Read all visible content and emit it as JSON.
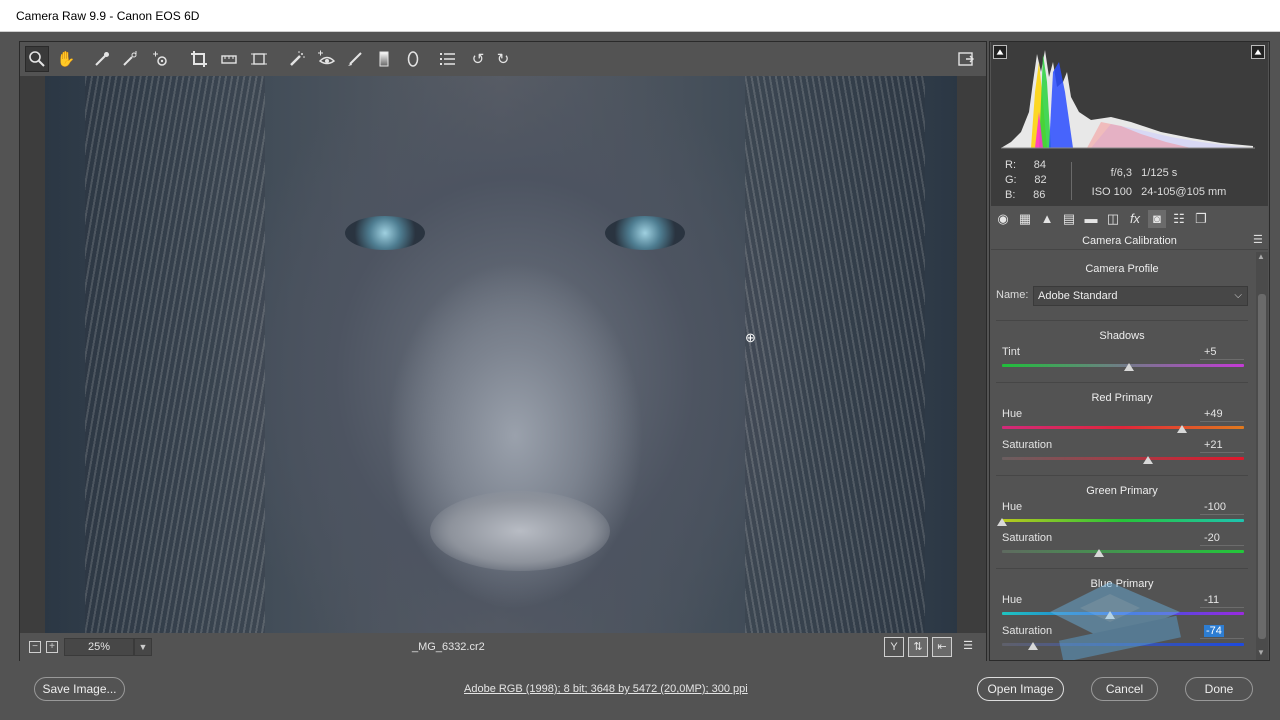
{
  "window": {
    "title": "Camera Raw 9.9  -  Canon EOS 6D"
  },
  "toolbar": {
    "tools": [
      "zoom-tool",
      "hand-tool",
      "white-balance-tool",
      "color-sampler-tool",
      "targeted-adjustment-tool",
      "crop-tool",
      "straighten-tool",
      "transform-tool",
      "spot-removal-tool",
      "red-eye-tool",
      "adjustment-brush-tool",
      "graduated-filter-tool",
      "radial-filter-tool",
      "preferences-tool",
      "rotate-ccw-tool",
      "rotate-cw-tool"
    ],
    "active_tool": "zoom-tool"
  },
  "preview": {
    "zoom_value": "25%",
    "filename": "_MG_6332.cr2"
  },
  "readout": {
    "r_label": "R:",
    "r_value": "84",
    "g_label": "G:",
    "g_value": "82",
    "b_label": "B:",
    "b_value": "86",
    "aperture": "f/6,3",
    "shutter": "1/125 s",
    "iso": "ISO 100",
    "lens": "24-105@105 mm"
  },
  "panel": {
    "title": "Camera Calibration",
    "camera_profile_heading": "Camera Profile",
    "name_label": "Name:",
    "name_value": "Adobe Standard",
    "shadows": {
      "heading": "Shadows",
      "tint_label": "Tint",
      "tint_value": "+5"
    },
    "red_primary": {
      "heading": "Red Primary",
      "hue_label": "Hue",
      "hue_value": "+49",
      "sat_label": "Saturation",
      "sat_value": "+21"
    },
    "green_primary": {
      "heading": "Green Primary",
      "hue_label": "Hue",
      "hue_value": "-100",
      "sat_label": "Saturation",
      "sat_value": "-20"
    },
    "blue_primary": {
      "heading": "Blue Primary",
      "hue_label": "Hue",
      "hue_value": "-11",
      "sat_label": "Saturation",
      "sat_value": "-74"
    }
  },
  "slider_levels": {
    "shadows_tint": 5,
    "red_hue": 49,
    "red_sat": 21,
    "green_hue": -100,
    "green_sat": -20,
    "blue_hue": -11,
    "blue_sat": -74,
    "range": [
      -100,
      100
    ]
  },
  "footer": {
    "save_label": "Save Image...",
    "workflow_text": "Adobe RGB (1998); 8 bit; 3648 by 5472 (20,0MP); 300 ppi",
    "open_label": "Open Image",
    "cancel_label": "Cancel",
    "done_label": "Done"
  },
  "colors": {
    "panel_bg": "#535353",
    "selection": "#2d7dd2"
  }
}
